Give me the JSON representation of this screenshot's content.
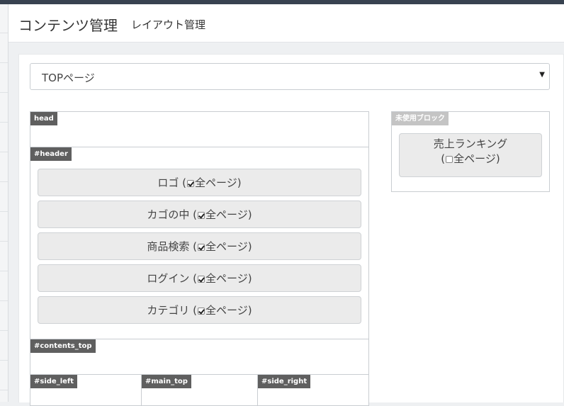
{
  "header": {
    "title": "コンテンツ管理",
    "subtitle": "レイアウト管理"
  },
  "page_select": {
    "selected": "TOPページ"
  },
  "areas": {
    "head": {
      "label": "head"
    },
    "header": {
      "label": "#header",
      "blocks": [
        {
          "name": "ロゴ",
          "open": " (",
          "all_pages": "全ページ)",
          "checked": true
        },
        {
          "name": "カゴの中",
          "open": " (",
          "all_pages": "全ページ)",
          "checked": true
        },
        {
          "name": "商品検索",
          "open": " (",
          "all_pages": "全ページ)",
          "checked": true
        },
        {
          "name": "ログイン",
          "open": " (",
          "all_pages": "全ページ)",
          "checked": true
        },
        {
          "name": "カテゴリ",
          "open": " (",
          "all_pages": "全ページ)",
          "checked": true
        }
      ]
    },
    "contents_top": {
      "label": "#contents_top"
    },
    "side_left": {
      "label": "#side_left"
    },
    "main_top": {
      "label": "#main_top"
    },
    "side_right": {
      "label": "#side_right"
    },
    "unused": {
      "label": "未使用ブロック",
      "blocks": [
        {
          "name": "売上ランキング",
          "open": "(",
          "all_pages": "全ページ)",
          "checked": false
        }
      ]
    }
  }
}
